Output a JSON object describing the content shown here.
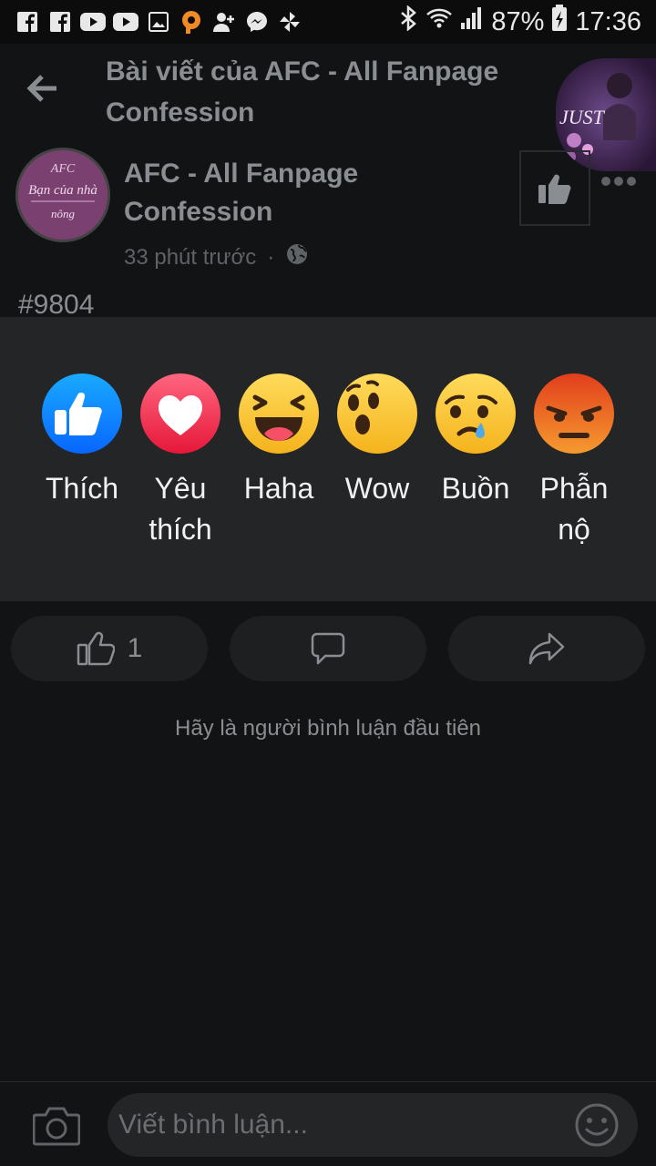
{
  "status_bar": {
    "icons": [
      "facebook-icon",
      "facebook-icon",
      "youtube-icon",
      "youtube-icon",
      "gallery-icon",
      "p-app-icon",
      "add-contact-icon",
      "messenger-icon",
      "pinwheel-icon"
    ],
    "right_icons": [
      "bluetooth-icon",
      "wifi-icon",
      "signal-icon"
    ],
    "battery": "87%",
    "time": "17:36"
  },
  "header": {
    "title": "Bài viết của AFC - All Fanpage Confession",
    "back_icon": "arrow-left-icon",
    "chathead_text": "JUST"
  },
  "post": {
    "page_name": "AFC - All Fanpage Confession",
    "avatar_text_1": "AFC",
    "avatar_text_2": "Bạn của nhà",
    "avatar_text_3": "nông",
    "time_ago": "33 phút trước",
    "separator": "·",
    "privacy_icon": "globe-icon",
    "tag": "#9804"
  },
  "reactions": [
    {
      "label": "Thích",
      "icon": "like-reaction-icon"
    },
    {
      "label": "Yêu thích",
      "icon": "love-reaction-icon"
    },
    {
      "label": "Haha",
      "icon": "haha-reaction-icon"
    },
    {
      "label": "Wow",
      "icon": "wow-reaction-icon"
    },
    {
      "label": "Buồn",
      "icon": "sad-reaction-icon"
    },
    {
      "label": "Phẫn nộ",
      "icon": "angry-reaction-icon"
    }
  ],
  "actions": {
    "like_count": "1",
    "like_icon": "thumbs-up-icon",
    "comment_icon": "comment-icon",
    "share_icon": "share-icon"
  },
  "comments": {
    "empty_text": "Hãy là người bình luận đầu tiên"
  },
  "composer": {
    "placeholder": "Viết bình luận...",
    "camera_icon": "camera-icon",
    "emoji_icon": "smiley-icon"
  },
  "colors": {
    "background": "#121314",
    "tray": "#242526",
    "like_blue": "#1877f2",
    "love_red": "#f33e58",
    "reaction_yellow": "#fcd34d",
    "angry_orange": "#e9710f"
  }
}
